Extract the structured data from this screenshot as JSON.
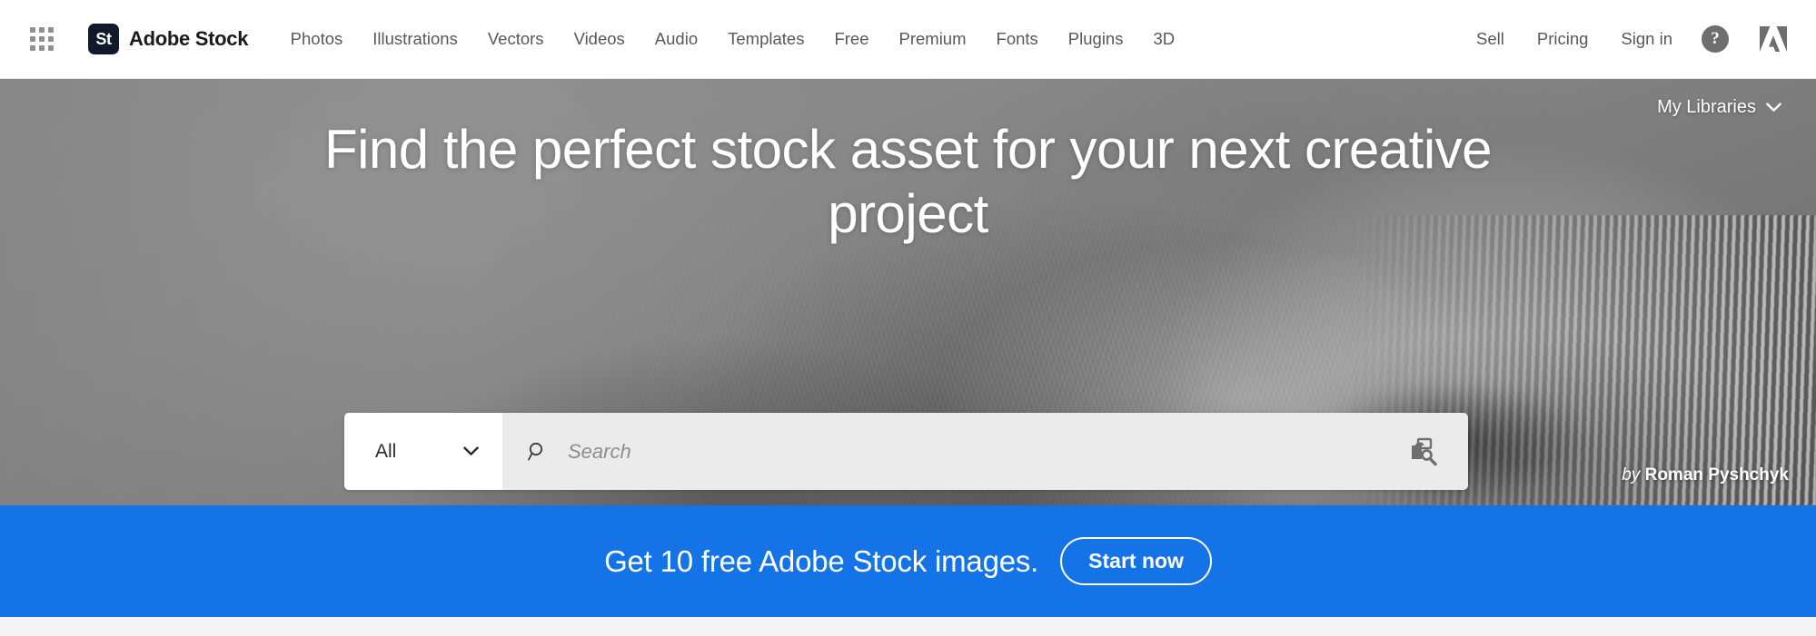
{
  "header": {
    "app_grid_icon": "app-grid-icon",
    "brand": {
      "mark": "St",
      "name": "Adobe Stock"
    },
    "nav": [
      {
        "label": "Photos"
      },
      {
        "label": "Illustrations"
      },
      {
        "label": "Vectors"
      },
      {
        "label": "Videos"
      },
      {
        "label": "Audio"
      },
      {
        "label": "Templates"
      },
      {
        "label": "Free"
      },
      {
        "label": "Premium"
      },
      {
        "label": "Fonts"
      },
      {
        "label": "Plugins"
      },
      {
        "label": "3D"
      }
    ],
    "utilities": [
      {
        "label": "Sell"
      },
      {
        "label": "Pricing"
      },
      {
        "label": "Sign in"
      }
    ],
    "help_icon": "help-circle-icon",
    "help_label": "?",
    "adobe_logo_icon": "adobe-logo-icon"
  },
  "hero": {
    "my_libraries": {
      "label": "My Libraries",
      "icon": "chevron-down-icon"
    },
    "title": "Find the perfect stock asset for your next creative project",
    "search": {
      "type_selected": "All",
      "type_icon": "chevron-down-icon",
      "search_icon": "search-icon",
      "placeholder": "Search",
      "value": "",
      "visual_search_icon": "visual-search-icon"
    },
    "credit_prefix": "by",
    "credit_author": "Roman Pyshchyk"
  },
  "promo": {
    "text": "Get 10 free Adobe Stock images.",
    "button_label": "Start now"
  },
  "colors": {
    "brand_dark": "#12192b",
    "promo_blue": "#1473e6",
    "nav_text": "#585858",
    "search_field_bg": "#ebebeb",
    "hero_bg": "#8a8a8a"
  }
}
